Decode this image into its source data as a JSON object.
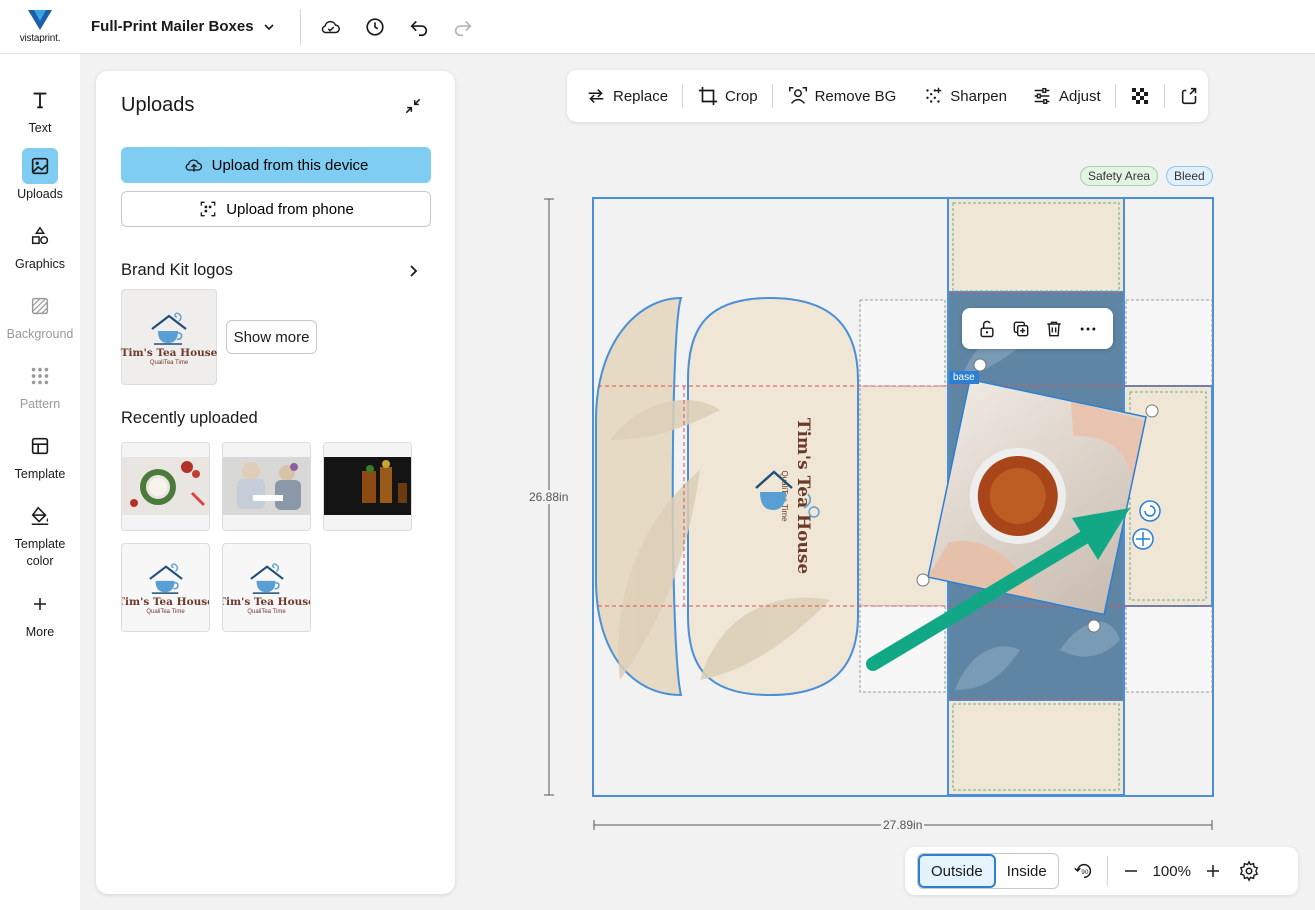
{
  "header": {
    "brand": "vistaprint.",
    "doc_title": "Full-Print Mailer Boxes",
    "icons": [
      "cloud-save-icon",
      "history-icon",
      "undo-icon",
      "redo-icon"
    ]
  },
  "rail": {
    "items": [
      {
        "label": "Text",
        "icon": "text-icon"
      },
      {
        "label": "Uploads",
        "icon": "image-icon",
        "active": true
      },
      {
        "label": "Graphics",
        "icon": "shapes-icon"
      },
      {
        "label": "Background",
        "icon": "background-icon",
        "disabled": true
      },
      {
        "label": "Pattern",
        "icon": "pattern-icon",
        "disabled": true
      },
      {
        "label": "Template",
        "icon": "template-icon"
      },
      {
        "label": "Template color",
        "icon": "paint-bucket-icon"
      },
      {
        "label": "More",
        "icon": "plus-icon"
      }
    ]
  },
  "uploads": {
    "title": "Uploads",
    "upload_device": "Upload from this device",
    "upload_phone": "Upload from phone",
    "brand_kit_title": "Brand Kit logos",
    "show_more": "Show more",
    "recently_title": "Recently uploaded",
    "logo_name": "Tim's Tea House",
    "logo_tagline": "QualiTea Time"
  },
  "toolbar": {
    "replace": "Replace",
    "crop": "Crop",
    "remove_bg": "Remove BG",
    "sharpen": "Sharpen",
    "adjust": "Adjust"
  },
  "canvas": {
    "safety_chip": "Safety Area",
    "bleed_chip": "Bleed",
    "height_label": "26.88in",
    "width_label": "27.89in",
    "base_tag": "base",
    "box_logo_name": "Tim's Tea House",
    "box_logo_tagline": "QualiTea Time"
  },
  "bottom": {
    "outside": "Outside",
    "inside": "Inside",
    "zoom": "100%"
  },
  "colors": {
    "accent": "#7fcdf2",
    "selection": "#2d7fd3",
    "box_cream": "#efe6d6",
    "box_blue": "#5e86a4",
    "arrow": "#12a886"
  }
}
